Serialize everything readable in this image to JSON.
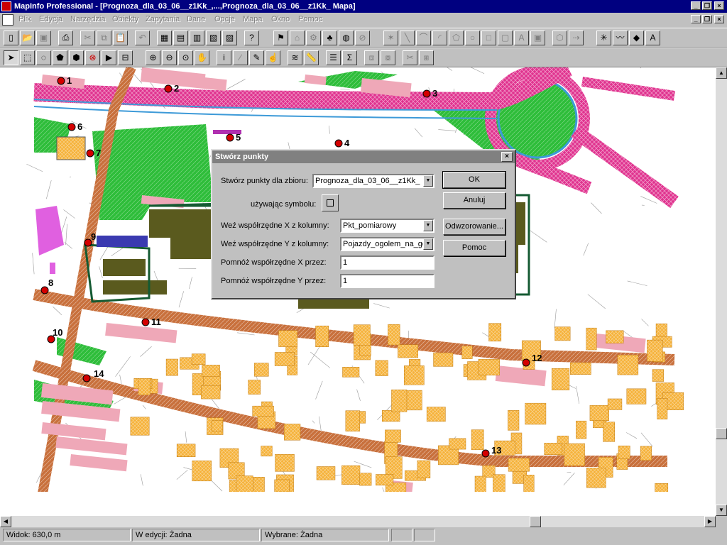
{
  "app": {
    "title": "MapInfo Professional - [Prognoza_dla_03_06__z1Kk_,...,Prognoza_dla_03_06__z1Kk_ Mapa]"
  },
  "menu": [
    "Plik",
    "Edycja",
    "Narzędzia",
    "Obiekty",
    "Zapytania",
    "Dane",
    "Opcje",
    "Mapa",
    "Okno",
    "Pomoc"
  ],
  "map": {
    "point_labels": [
      "1",
      "2",
      "3",
      "4",
      "5",
      "6",
      "7",
      "8",
      "9",
      "10",
      "11",
      "12",
      "13",
      "14"
    ],
    "colors": {
      "road": "#e0338f",
      "street": "#c8703c",
      "green": "#2ebd3a",
      "building": "#efa8b8",
      "house": "#f5b23a",
      "olive": "#5a5a1e",
      "water": "#3d9ad8"
    }
  },
  "dialog": {
    "title": "Stwórz punkty",
    "close": "×",
    "rows": {
      "set_label": "Stwórz punkty dla zbioru:",
      "set_value": "Prognoza_dla_03_06__z1Kk_",
      "symbol_label": "używając symbolu:",
      "x_label": "Weź współrzędne X z kolumny:",
      "x_value": "Pkt_pomiarowy",
      "y_label": "Weź współrzędne Y z kolumny:",
      "y_value": "Pojazdy_ogolem_na_go",
      "mult_x_label": "Pomnóż współrzędne X przez:",
      "mult_x_value": "1",
      "mult_y_label": "Pomnóż współrzędne Y przez:",
      "mult_y_value": "1"
    },
    "buttons": {
      "ok": "OK",
      "cancel": "Anuluj",
      "projection": "Odwzorowanie...",
      "help": "Pomoc"
    }
  },
  "status": {
    "view": "Widok: 630,0 m",
    "editing": "W edycji:   Żadna",
    "selected": "Wybrane: Żadna"
  }
}
